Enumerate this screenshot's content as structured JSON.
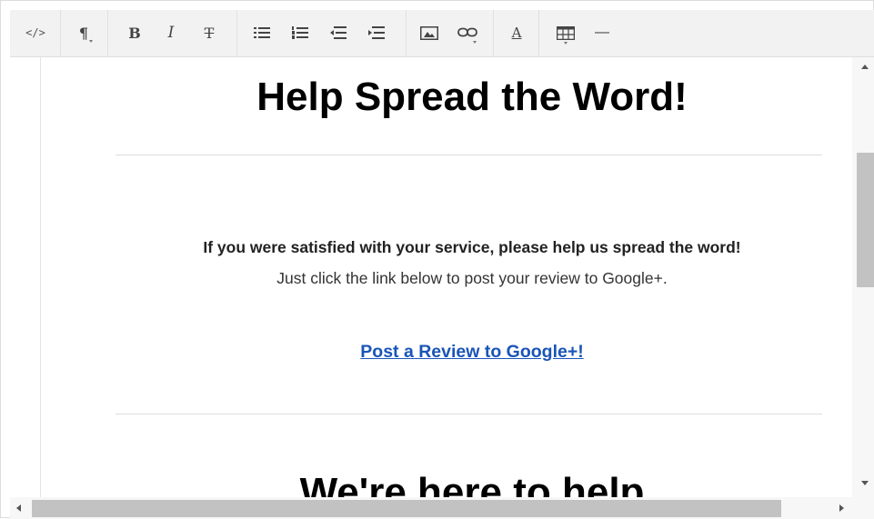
{
  "toolbar": {
    "buttons": [
      {
        "name": "code-view",
        "icon": "code-icon",
        "glyph": "</>"
      },
      {
        "name": "paragraph-format",
        "icon": "paragraph-icon",
        "glyph": "¶"
      },
      {
        "name": "bold",
        "icon": "bold-icon",
        "glyph": "B"
      },
      {
        "name": "italic",
        "icon": "italic-icon",
        "glyph": "I"
      },
      {
        "name": "strikethrough",
        "icon": "strikethrough-icon",
        "glyph": "T"
      },
      {
        "name": "unordered-list",
        "icon": "bulleted-list-icon"
      },
      {
        "name": "ordered-list",
        "icon": "numbered-list-icon"
      },
      {
        "name": "outdent",
        "icon": "outdent-icon"
      },
      {
        "name": "indent",
        "icon": "indent-icon"
      },
      {
        "name": "insert-image",
        "icon": "image-icon"
      },
      {
        "name": "insert-link",
        "icon": "link-icon"
      },
      {
        "name": "font-color",
        "icon": "font-color-icon",
        "glyph": "A"
      },
      {
        "name": "insert-table",
        "icon": "table-icon"
      },
      {
        "name": "horizontal-rule",
        "icon": "horizontal-rule-icon",
        "glyph": "—"
      }
    ]
  },
  "content": {
    "heading": "Help Spread the Word!",
    "bold_text": "If you were satisfied with your service, please help us spread the word!",
    "plain_text": "Just click the link below to post your review to Google+.",
    "link_text": "Post a Review to Google+!",
    "heading2": "We're here to help"
  },
  "colors": {
    "link": "#1a55b8",
    "toolbar_bg": "#f2f2f2",
    "scroll_thumb": "#c2c2c2"
  }
}
